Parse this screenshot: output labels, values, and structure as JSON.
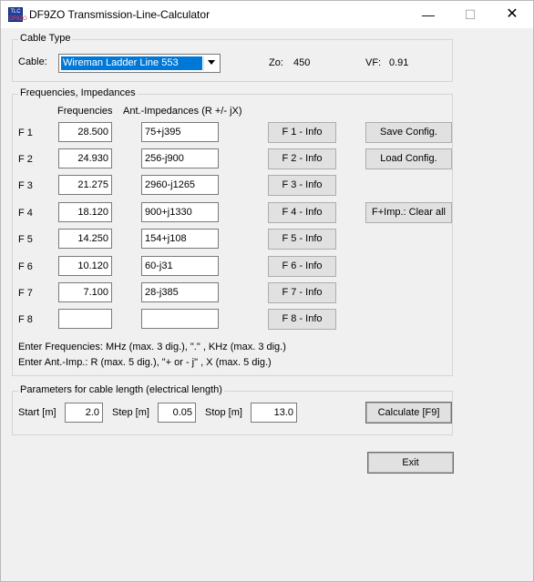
{
  "window": {
    "title": "DF9ZO Transmission-Line-Calculator",
    "icon_text_top": "TLC",
    "icon_text_bottom": "DF9ZO",
    "minimize": "—",
    "maximize": "☐",
    "close": "✕"
  },
  "cable_type": {
    "group_title": "Cable Type",
    "cable_label": "Cable:",
    "selected_cable": "Wireman Ladder Line 553",
    "zo_label": "Zo:",
    "zo_value": "450",
    "vf_label": "VF:",
    "vf_value": "0.91"
  },
  "freq": {
    "group_title": "Frequencies, Impedances",
    "col_freq": "Frequencies",
    "col_imp": "Ant.-Impedances (R +/- jX)",
    "rows": [
      {
        "label": "F 1",
        "freq": "28.500",
        "imp": "75+j395",
        "info": "F 1 - Info"
      },
      {
        "label": "F 2",
        "freq": "24.930",
        "imp": "256-j900",
        "info": "F 2 - Info"
      },
      {
        "label": "F 3",
        "freq": "21.275",
        "imp": "2960-j1265",
        "info": "F 3 - Info"
      },
      {
        "label": "F 4",
        "freq": "18.120",
        "imp": "900+j1330",
        "info": "F 4 - Info"
      },
      {
        "label": "F 5",
        "freq": "14.250",
        "imp": "154+j108",
        "info": "F 5 - Info"
      },
      {
        "label": "F 6",
        "freq": "10.120",
        "imp": "60-j31",
        "info": "F 6 - Info"
      },
      {
        "label": "F 7",
        "freq": "7.100",
        "imp": "28-j385",
        "info": "F 7 - Info"
      },
      {
        "label": "F 8",
        "freq": "",
        "imp": "",
        "info": "F 8 - Info"
      }
    ],
    "save_config": "Save Config.",
    "load_config": "Load Config.",
    "clear_all": "F+Imp.: Clear all",
    "hint_freq": "Enter Frequencies: MHz (max. 3 dig.), \".\" , KHz (max. 3 dig.)",
    "hint_imp": "Enter Ant.-Imp.: R (max. 5 dig.), \"+ or - j\" , X (max. 5 dig.)"
  },
  "params": {
    "group_title": "Parameters for cable length (electrical length)",
    "start_label": "Start [m]",
    "start_value": "2.0",
    "step_label": "Step [m]",
    "step_value": "0.05",
    "stop_label": "Stop [m]",
    "stop_value": "13.0",
    "calculate": "Calculate [F9]"
  },
  "exit_label": "Exit",
  "colors": {
    "selection": "#0078d7",
    "window_bg": "#f0f0f0",
    "titlebar_bg": "#ffffff"
  }
}
